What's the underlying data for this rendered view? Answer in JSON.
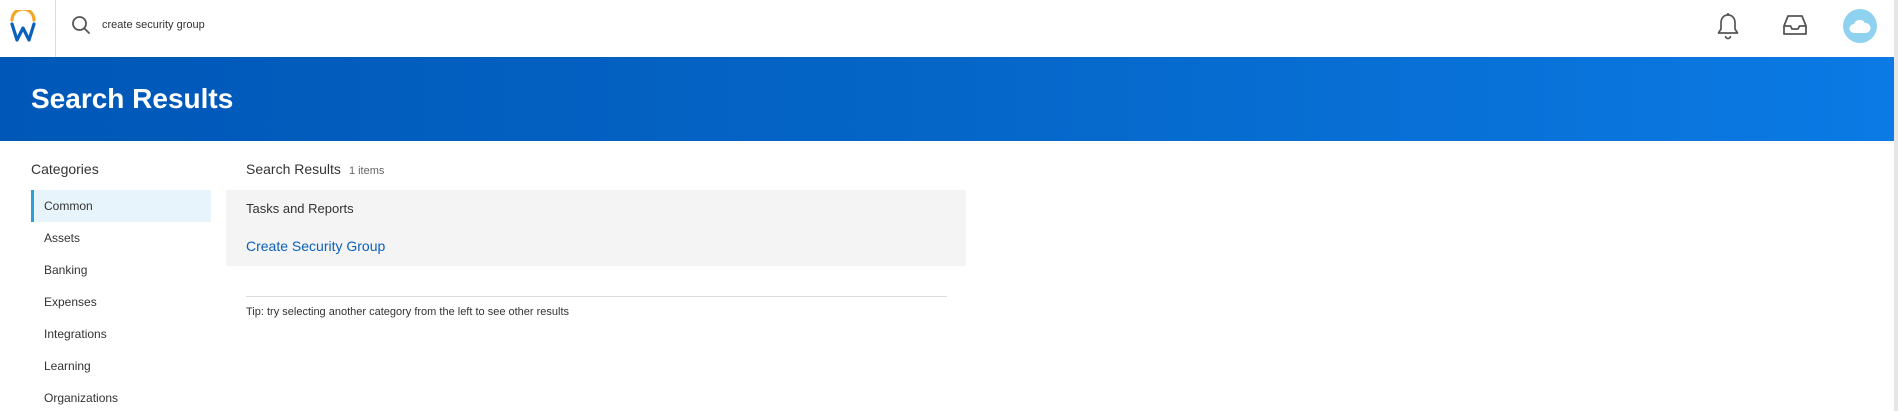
{
  "topbar": {
    "logo_icon": "workday-logo-icon",
    "search": {
      "icon": "search-icon",
      "value": "create security group",
      "placeholder": "Search"
    },
    "notifications_icon": "bell-icon",
    "inbox_icon": "inbox-icon",
    "avatar_icon": "cloud-avatar-icon"
  },
  "banner": {
    "title": "Search Results"
  },
  "sidebar": {
    "title": "Categories",
    "items": [
      {
        "label": "Common",
        "active": true
      },
      {
        "label": "Assets"
      },
      {
        "label": "Banking"
      },
      {
        "label": "Expenses"
      },
      {
        "label": "Integrations"
      },
      {
        "label": "Learning"
      },
      {
        "label": "Organizations"
      }
    ]
  },
  "results": {
    "title": "Search Results",
    "count": "1 items",
    "section_label": "Tasks and Reports",
    "items": [
      {
        "label": "Create Security Group"
      }
    ],
    "tip": "Tip: try selecting another category from the left to see other results"
  },
  "colors": {
    "banner_start": "#0057b7",
    "banner_end": "#0b7ae4",
    "link": "#0a61bc",
    "active_indicator": "#2a9fd8",
    "logo_orange": "#f5a623",
    "logo_blue": "#0a61bc"
  }
}
